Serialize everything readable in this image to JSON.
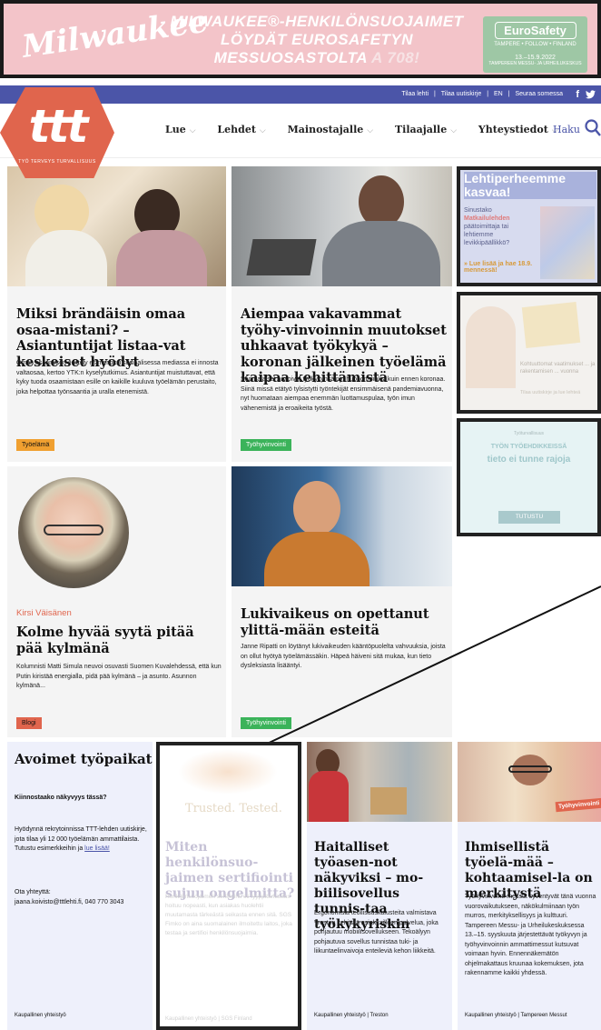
{
  "banner": {
    "logo": "Milwaukee",
    "headline_1": "MILWAUKEE®-HENKILÖNSUOJAIMET",
    "headline_2": "LÖYDÄT EUROSAFETYN",
    "headline_3": "MESSUOSASTOLTA",
    "headline_4": "A 708!",
    "euro_title": "EuroSafety",
    "euro_cities": "TAMPERE • FOLLOW • FINLAND",
    "euro_dates": "13.–15.9.2022",
    "euro_place": "TAMPEREEN MESSU- JA URHEILUKESKUS"
  },
  "topbar": {
    "links": [
      "Tilaa lehti",
      "|",
      "Tilaa uutiskirje",
      "|",
      "EN",
      "|",
      "Seuraa somessa"
    ],
    "facebook": "f",
    "twitter": "t"
  },
  "header": {
    "logo_text": "ttt",
    "logo_sub": "TYÖ TERVEYS TURVALLISUUS",
    "nav": [
      "Lue",
      "Lehdet",
      "Mainostajalle",
      "Tilaajalle",
      "Yhteystiedot"
    ],
    "search_label": "Haku"
  },
  "articles": [
    {
      "title": "Miksi brändäisin omaa osaa-mistani? – Asiantuntijat listaa-vat keskeiset hyödyt",
      "body": "Oman osaamisen esittely esimerkiksi sosiaalisessa mediassa ei innosta valtaosaa, kertoo YTK:n kyselytutkimus. Asiantuntijat muistuttavat, että kyky tuoda osaamistaan esille on kaikille kuuluva työelämän perustaito, joka helpottaa työnsaantia ja uralla etenemistä.",
      "tag": "Työelämä"
    },
    {
      "title": "Aiempaa vakavammat työhy-vinvoinnin muutokset uhkaavat työkykyä – koronan jälkeinen työelämä kaipaa kehittämistä",
      "body": "Suomalaiset arvioivat työkykynsä nyt huonommaksi kuin ennen koronaa. Siinä missä etätyö tylsistytti työntekijät ensimmäisenä pandemiavuonna, nyt huomataan aiempaa enemmän luottamuspulaa, työn imun vähenemistä ja eroaikeita työstä.",
      "tag": "Työhyvinvointi"
    },
    {
      "author": "Kirsi Väisänen",
      "title": "Kolme hyvää syytä pitää pää kylmänä",
      "body": "Kolumnisti Matti Simula neuvoi osuvasti Suomen Kuvalehdessä, että kun Putin kiristää energialla, pidä pää kylmänä – ja asunto. Asunnon kylmänä...",
      "tag": "Blogi"
    },
    {
      "title": "Lukivaikeus on opettanut ylittä-mään esteitä",
      "body": "Janne Ripatti on löytänyt lukivaikeuden kääntöpuolelta vahvuuksia, joista on ollut hyötyä työelämässäkin. Häpeä häiveni sitä mukaa, kun tieto dysleksiasta lisääntyi.",
      "tag": "Työhyvinvointi"
    }
  ],
  "ads": {
    "ad1_title": "Lehtiperheemme kasvaa!",
    "ad1_body_1": "Sinustako",
    "ad1_body_hl": "Matkailulehden",
    "ad1_body_2": "päätoimittaja tai lehtiemme levikkipäällikkö?",
    "ad1_link": "» Lue lisää ja hae 18.9. mennessä!",
    "ad2_title": "Kohtuuttomat vaatimukset ... ja rakentamisen ... vuonna",
    "ad2_sub": "Tilaa uutiskirje ja lue lehteä",
    "ad3_small": "Työturvallisuus",
    "ad3_line1": "TYÖN TYÖEHDIKKEISSÄ",
    "ad3_line2": "tieto ei tunne rajoja",
    "ad3_button": "TUTUSTU"
  },
  "jobs": {
    "title": "Avoimet työpaikat",
    "q": "Kiinnostaako näkyvyys tässä?",
    "body": "Hyödynnä rekrytoinnissa TTT-lehden uutiskirje, jota tilaa yli 12 000 työelämän ammattilaista. Tutustu esimerkkeihin ja",
    "link": "lue lisää!",
    "contact_label": "Ota yhteyttä:",
    "contact": "jaana.koivisto@tttlehti.fi, 040 770 3043",
    "footer": "Kaupallinen yhteistyö"
  },
  "sponsored": [
    {
      "brand": "Trusted. Tested.",
      "title": "Miten henkilönsuo-jaimen sertifiointi sujuu ongelmitta?",
      "body": "Henkilönsuojaimen sertifiointi eli tyyppitarkastus hoituu nopeasti, kun asiakas huolehtii muutamasta tärkeästä seikasta ennen sitä. SGS Fimko on aina suomalainen ilmoitettu laitos, joka testaa ja sertifioi henkilönsuojaimia.",
      "footer": "Kaupallinen yhteistyö | SGS Finland"
    },
    {
      "title": "Haitalliset työasen-not näkyviksi – mo-biilisovellus tunnis-taa työkykyriskin",
      "body": "Ergonomisia teollisuuskalusteita valmistava Treston kehittää asiakkailleen palvelua, joka pohjautuu mobiilisovellukseen. Tekoälyyn pohjautuva sovellus tunnistaa tuki- ja liikuntaelinvaivoja enteileviä kehon liikkeitä.",
      "footer": "Kaupallinen yhteistyö | Treston"
    },
    {
      "badge": "Työhyvinvointi",
      "title": "Ihmisellistä työelä-mää – kohtaamisel-la on merkitystä",
      "body": "Työhyvinvointi-messut syventyvät tänä vuonna vuorovaikutukseen, näkökulmiinaan työn murros, merkityksellisyys ja kulttuuri. Tampereen Messu- ja Urheilukeskuksessa 13.–15. syyskuuta järjestettävät työkyvyn ja työhyvinvoinnin ammattimessut kutsuvat voimaan hyvin. Ennennäkemätön ohjelmakattaus kruunaa kokemuksen, jota rakennamme kaikki yhdessä.",
      "footer": "Kaupallinen yhteistyö | Tampereen Messut"
    }
  ],
  "colors": {
    "accent_blue": "#4b55a8",
    "logo_red": "#e0654d",
    "tag_orange": "#f0a030",
    "tag_green": "#3bb35a"
  }
}
